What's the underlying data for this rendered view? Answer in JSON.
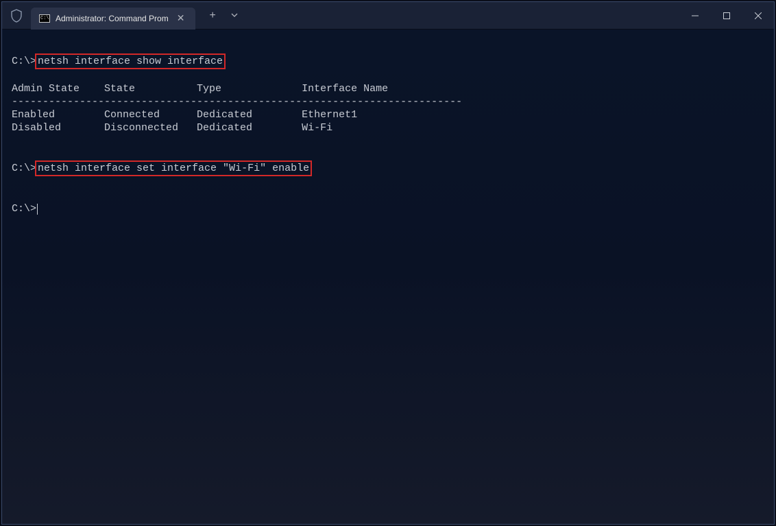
{
  "tab": {
    "title": "Administrator: Command Prom"
  },
  "prompt": "C:\\>",
  "command1": "netsh interface show interface",
  "table": {
    "header_line": "Admin State    State          Type             Interface Name",
    "divider": "-------------------------------------------------------------------------",
    "rows": [
      "Enabled        Connected      Dedicated        Ethernet1",
      "Disabled       Disconnected   Dedicated        Wi-Fi"
    ]
  },
  "command2": "netsh interface set interface \"Wi-Fi\" enable"
}
